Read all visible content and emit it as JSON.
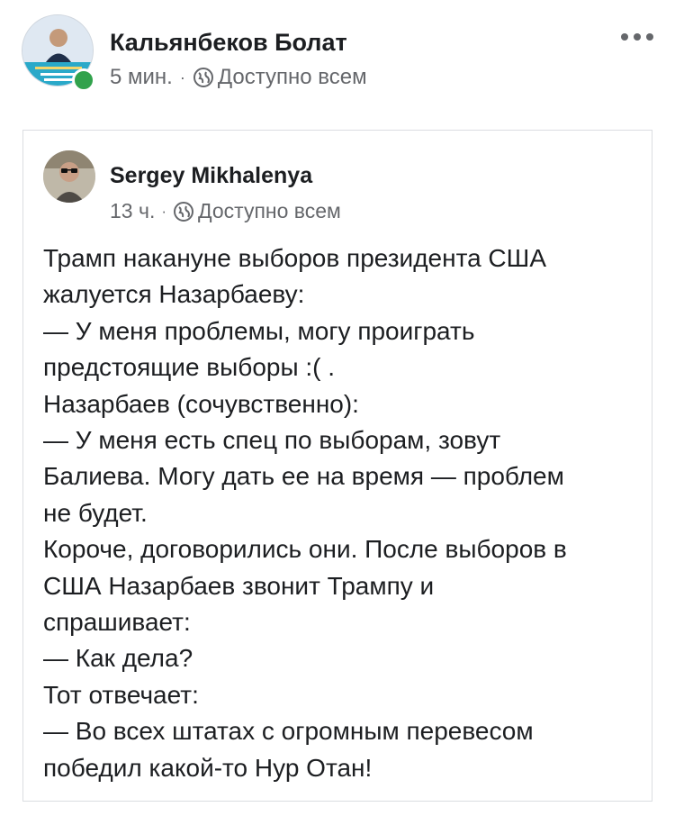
{
  "post": {
    "author": "Кальянбеков Болат",
    "time": "5 мин.",
    "separator": "·",
    "audience": "Доступно всем",
    "audience_icon": "globe-icon",
    "avatar_icon": "profile-photo",
    "online_status": "online",
    "menu_icon": "more-options-icon"
  },
  "shared_post": {
    "author": "Sergey Mikhalenya",
    "time": "13 ч.",
    "separator": "·",
    "audience": "Доступно всем",
    "audience_icon": "globe-icon",
    "avatar_icon": "profile-photo",
    "lines": [
      "Трамп накануне выборов президента США",
      "жалуется Назарбаеву:",
      "— У меня проблемы, могу проиграть",
      "предстоящие выборы :( .",
      "Назарбаев (сочувственно):",
      "— У меня есть спец по выборам, зовут",
      "Балиева. Могу дать ее на время — проблем",
      "не будет.",
      "Короче, договорились они. После выборов в",
      "США Назарбаев звонит Трампу и",
      "спрашивает:",
      "— Как дела?",
      "Тот отвечает:",
      "— Во всех штатах с огромным перевесом",
      "победил какой-то Нур Отан!"
    ]
  },
  "colors": {
    "online_dot": "#31a24c",
    "meta_text": "#65676b",
    "border": "#dadde1"
  }
}
